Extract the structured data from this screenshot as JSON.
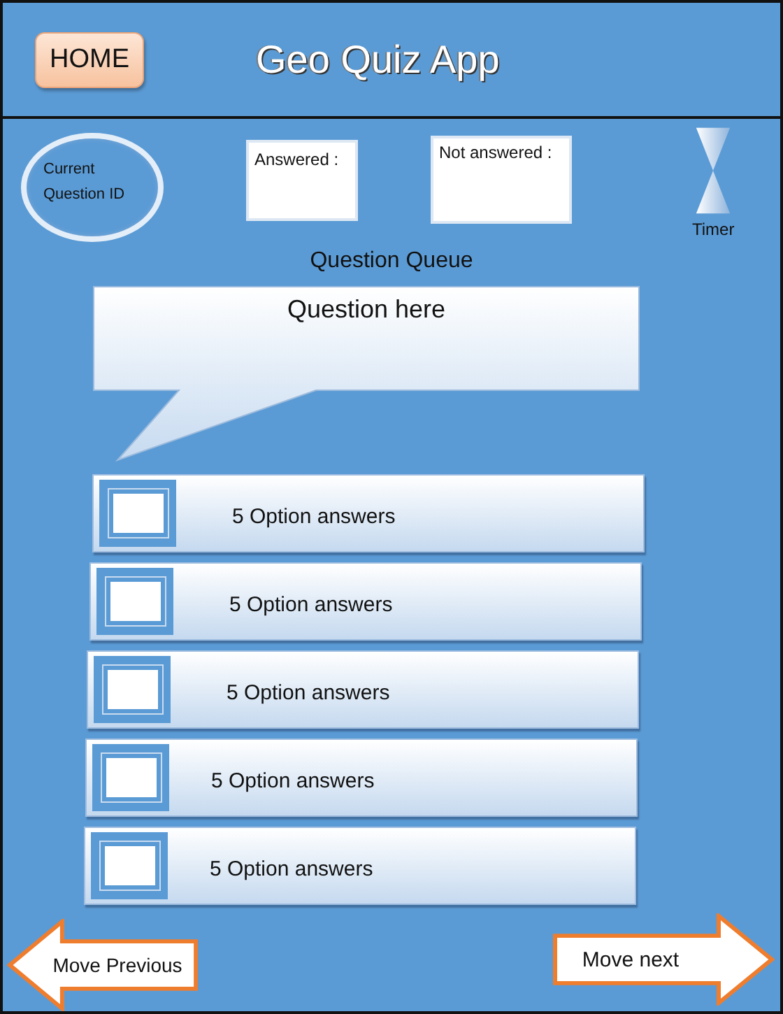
{
  "header": {
    "home_button": "HOME",
    "title": "Geo Quiz App"
  },
  "status": {
    "current_question": "Current Question ID",
    "answered": "Answered :",
    "not_answered": "Not answered :",
    "timer": "Timer",
    "queue": "Question Queue"
  },
  "question": "Question here",
  "options": [
    {
      "label": "5 Option answers",
      "checked": false
    },
    {
      "label": "5 Option answers",
      "checked": false
    },
    {
      "label": "5 Option answers",
      "checked": false
    },
    {
      "label": "5 Option answers",
      "checked": false
    },
    {
      "label": "5 Option answers",
      "checked": false
    }
  ],
  "navigation": {
    "previous": "Move Previous",
    "next": "Move next"
  }
}
